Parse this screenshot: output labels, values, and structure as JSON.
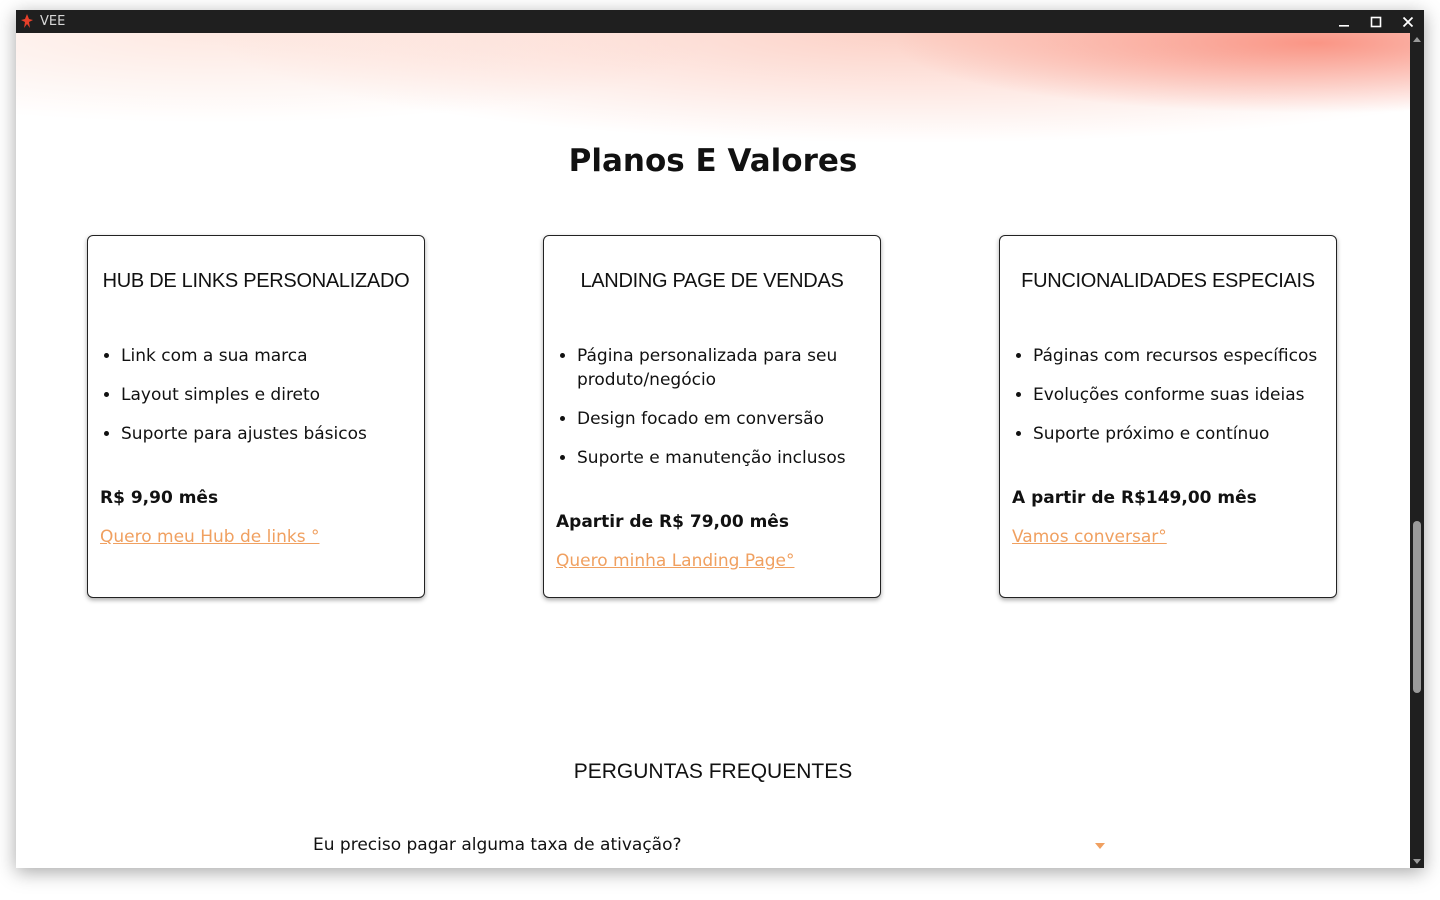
{
  "window": {
    "title": "VEE"
  },
  "pricing": {
    "title": "Planos E Valores",
    "cards": [
      {
        "title": "HUB DE LINKS PERSONALIZADO",
        "features": [
          "Link com a sua marca",
          "Layout simples e direto",
          "Suporte para ajustes básicos"
        ],
        "price": "R$ 9,90 mês",
        "cta": "Quero meu Hub de links °"
      },
      {
        "title": "LANDING PAGE DE VENDAS",
        "features": [
          "Página personalizada para seu produto/negócio",
          "Design focado em conversão",
          "Suporte e manutenção inclusos"
        ],
        "price": "Apartir de R$ 79,00 mês",
        "cta": "Quero minha Landing Page°"
      },
      {
        "title": "FUNCIONALIDADES ESPECIAIS",
        "features": [
          "Páginas com recursos específicos",
          "Evoluções conforme suas ideias",
          "Suporte próximo e contínuo"
        ],
        "price": "A partir de R$149,00 mês",
        "cta": "Vamos conversar°"
      }
    ]
  },
  "faq": {
    "heading": "PERGUNTAS FREQUENTES",
    "items": [
      {
        "question": "Eu preciso pagar alguma taxa de ativação?"
      }
    ]
  },
  "colors": {
    "accent": "#f0a060",
    "titlebar": "#1f1f1f"
  },
  "icons": [
    "app-logo-icon",
    "minimize-icon",
    "maximize-icon",
    "close-icon",
    "chevron-down-icon"
  ]
}
